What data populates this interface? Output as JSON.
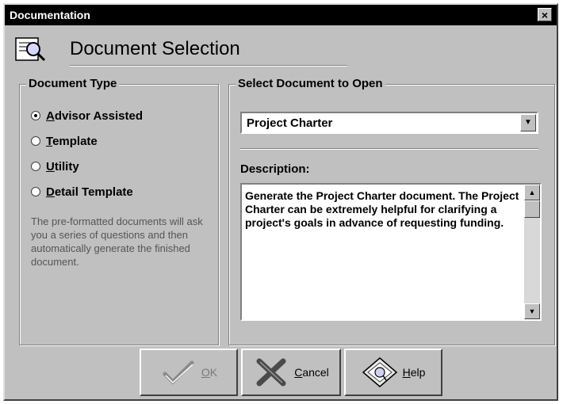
{
  "window": {
    "title": "Documentation",
    "close_glyph": "×"
  },
  "header": {
    "title": "Document Selection",
    "icon": "document-magnifier-icon"
  },
  "document_type": {
    "group_label": "Document Type",
    "options": [
      {
        "label": "Advisor Assisted",
        "accel": "A",
        "rest": "dvisor Assisted",
        "selected": true
      },
      {
        "label": "Template",
        "accel": "T",
        "rest": "emplate",
        "selected": false
      },
      {
        "label": "Utility",
        "accel": "U",
        "rest": "tility",
        "selected": false
      },
      {
        "label": "Detail Template",
        "accel": "D",
        "rest": "etail Template",
        "selected": false
      }
    ],
    "description": "The pre-formatted documents will ask you a series of questions and then automatically generate the finished document."
  },
  "select_document": {
    "group_label": "Select Document to Open",
    "selected_value": "Project Charter",
    "description_label": "Description:",
    "description_text": "Generate the Project Charter document. The Project Charter can be extremely helpful for clarifying a project's goals in advance of requesting funding."
  },
  "buttons": {
    "ok": {
      "accel": "O",
      "rest": "K",
      "enabled": false
    },
    "cancel": {
      "accel": "C",
      "rest": "ancel"
    },
    "help": {
      "accel": "H",
      "rest": "elp"
    }
  },
  "colors": {
    "face": "#c0c0c0",
    "titlebar": "#000000",
    "disabled_text": "#7a7a7a"
  }
}
